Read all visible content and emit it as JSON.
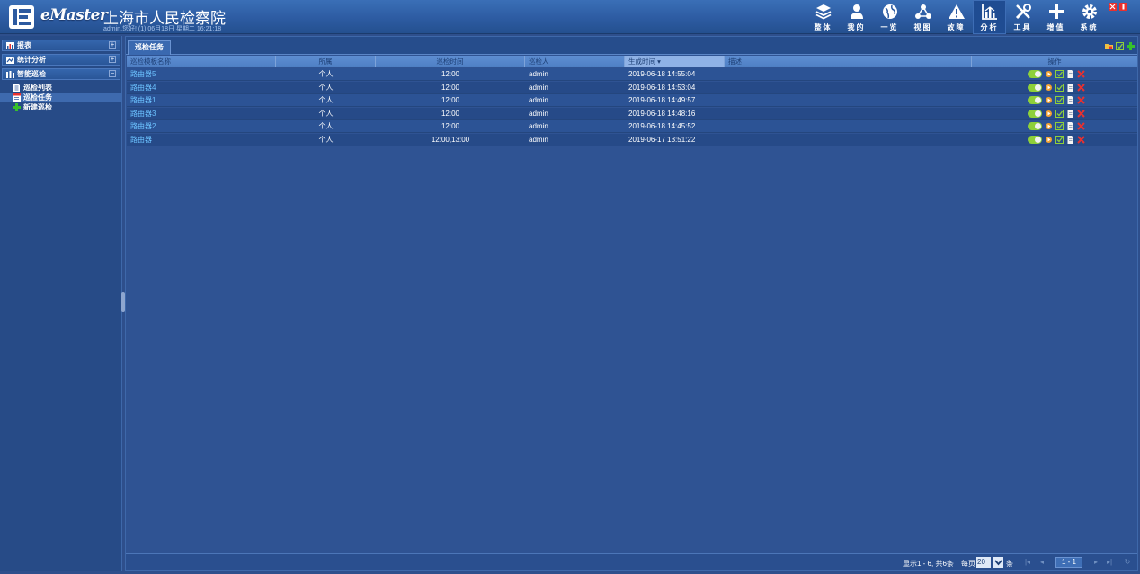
{
  "header": {
    "brand": "eMaster",
    "org_title": "上海市人民检察院",
    "user_line": "admin,您好! (1) 06月18日 星期二 16:21:18",
    "nav": [
      {
        "label": "整体",
        "icon": "layers-icon",
        "active": false
      },
      {
        "label": "我的",
        "icon": "user-icon",
        "active": false
      },
      {
        "label": "一览",
        "icon": "globe-icon",
        "active": false
      },
      {
        "label": "视图",
        "icon": "topology-icon",
        "active": false
      },
      {
        "label": "故障",
        "icon": "warning-icon",
        "active": false
      },
      {
        "label": "分析",
        "icon": "bar-chart-icon",
        "active": true
      },
      {
        "label": "工具",
        "icon": "tools-icon",
        "active": false
      },
      {
        "label": "增值",
        "icon": "plus-icon",
        "active": false
      },
      {
        "label": "系统",
        "icon": "gear-icon",
        "active": false
      }
    ]
  },
  "sidebar": {
    "groups": [
      {
        "label": "报表",
        "toggle": "+",
        "icon": "report-icon"
      },
      {
        "label": "统计分析",
        "toggle": "+",
        "icon": "statistics-icon"
      },
      {
        "label": "智能巡检",
        "toggle": "−",
        "icon": "inspection-icon"
      }
    ],
    "items": [
      {
        "label": "巡检列表",
        "icon": "document-icon",
        "active": false
      },
      {
        "label": "巡检任务",
        "icon": "calendar-icon",
        "active": true
      },
      {
        "label": "新建巡检",
        "icon": "add-icon",
        "active": false
      }
    ]
  },
  "main": {
    "tab_label": "巡检任务",
    "columns": [
      "巡检模板名称",
      "所属",
      "巡检时间",
      "巡检人",
      "生成时间",
      "描述",
      "操作"
    ],
    "rows": [
      {
        "name": "路由器5",
        "owner": "个人",
        "time": "12:00",
        "inspector": "admin",
        "created": "2019-06-18 14:55:04",
        "desc": ""
      },
      {
        "name": "路由器4",
        "owner": "个人",
        "time": "12:00",
        "inspector": "admin",
        "created": "2019-06-18 14:53:04",
        "desc": ""
      },
      {
        "name": "路由器1",
        "owner": "个人",
        "time": "12:00",
        "inspector": "admin",
        "created": "2019-06-18 14:49:57",
        "desc": ""
      },
      {
        "name": "路由器3",
        "owner": "个人",
        "time": "12:00",
        "inspector": "admin",
        "created": "2019-06-18 14:48:16",
        "desc": ""
      },
      {
        "name": "路由器2",
        "owner": "个人",
        "time": "12:00",
        "inspector": "admin",
        "created": "2019-06-18 14:45:52",
        "desc": ""
      },
      {
        "name": "路由器",
        "owner": "个人",
        "time": "12:00,13:00",
        "inspector": "admin",
        "created": "2019-06-17 13:51:22",
        "desc": ""
      }
    ]
  },
  "pager": {
    "info": "显示1 - 6, 共6条",
    "per_page_label": "每页",
    "per_page": "20",
    "unit": "条",
    "page": "1 - 1"
  },
  "colors": {
    "accent_green": "#8ed03a",
    "link_blue": "#6cc2ff",
    "delete_red": "#e8312f"
  }
}
